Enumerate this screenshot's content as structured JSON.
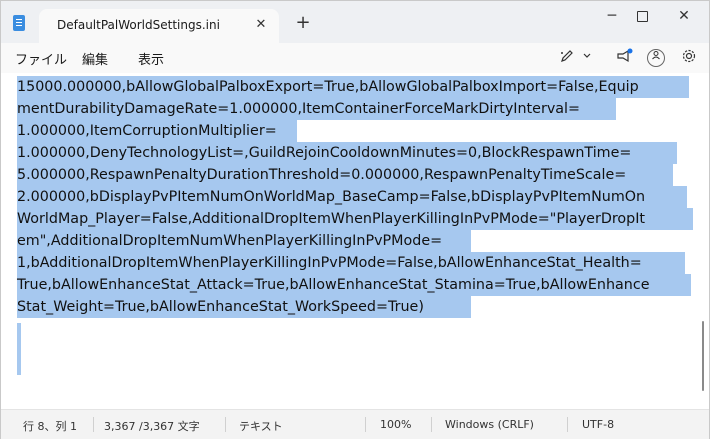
{
  "window": {
    "tab_title": "DefaultPalWorldSettings.ini",
    "close_tab_glyph": "✕",
    "new_tab_glyph": "+",
    "minimize_glyph": "─",
    "close_glyph": "✕"
  },
  "menu": {
    "file": "ファイル",
    "edit": "編集",
    "view": "表示"
  },
  "toolbar": {
    "icons": [
      "write-icon",
      "chevron-down-icon",
      "megaphone-icon",
      "account-icon",
      "gear-icon"
    ]
  },
  "editor": {
    "lines": [
      "15000.000000,bAllowGlobalPalboxExport=True,bAllowGlobalPalboxImport=False,Equip",
      "mentDurabilityDamageRate=1.000000,ItemContainerForceMarkDirtyInterval=",
      "1.000000,ItemCorruptionMultiplier=",
      "1.000000,DenyTechnologyList=,GuildRejoinCooldownMinutes=0,BlockRespawnTime=",
      "5.000000,RespawnPenaltyDurationThreshold=0.000000,RespawnPenaltyTimeScale=",
      "2.000000,bDisplayPvPItemNumOnWorldMap_BaseCamp=False,bDisplayPvPItemNumOn",
      "WorldMap_Player=False,AdditionalDropItemWhenPlayerKillingInPvPMode=\"PlayerDropIt",
      "em\",AdditionalDropItemNumWhenPlayerKillingInPvPMode=",
      "1,bAdditionalDropItemWhenPlayerKillingInPvPMode=False,bAllowEnhanceStat_Health=",
      "True,bAllowEnhanceStat_Attack=True,bAllowEnhanceStat_Stamina=True,bAllowEnhance",
      "Stat_Weight=True,bAllowEnhanceStat_WorkSpeed=True)"
    ]
  },
  "status": {
    "position": "行 8、列 1",
    "char_count": "3,367 /3,367 文字",
    "format": "テキスト",
    "zoom": "100%",
    "line_ending": "Windows (CRLF)",
    "encoding": "UTF-8"
  }
}
